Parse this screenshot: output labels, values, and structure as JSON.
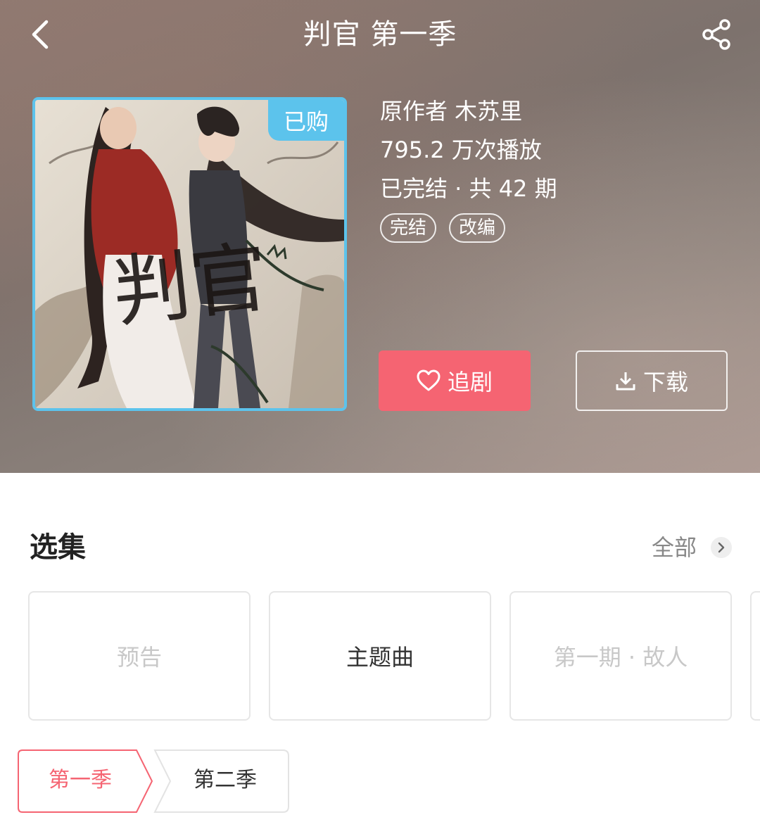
{
  "header": {
    "title": "判官 第一季",
    "back_icon": "chevron-left-icon",
    "share_icon": "share-icon"
  },
  "cover": {
    "badge": "已购",
    "badge_color": "#5cc3ec",
    "calligraphy": "判官"
  },
  "meta": {
    "author": "原作者 木苏里",
    "plays": "795.2 万次播放",
    "status": "已完结 · 共 42 期",
    "tags": [
      "完结",
      "改编"
    ]
  },
  "actions": {
    "follow_label": "追剧",
    "follow_color": "#f56472",
    "download_label": "下载"
  },
  "episodes": {
    "title": "选集",
    "see_all": "全部",
    "items": [
      "预告",
      "主题曲",
      "第一期 · 故人"
    ]
  },
  "seasons": {
    "items": [
      "第一季",
      "第二季"
    ],
    "active_color": "#f56472"
  }
}
